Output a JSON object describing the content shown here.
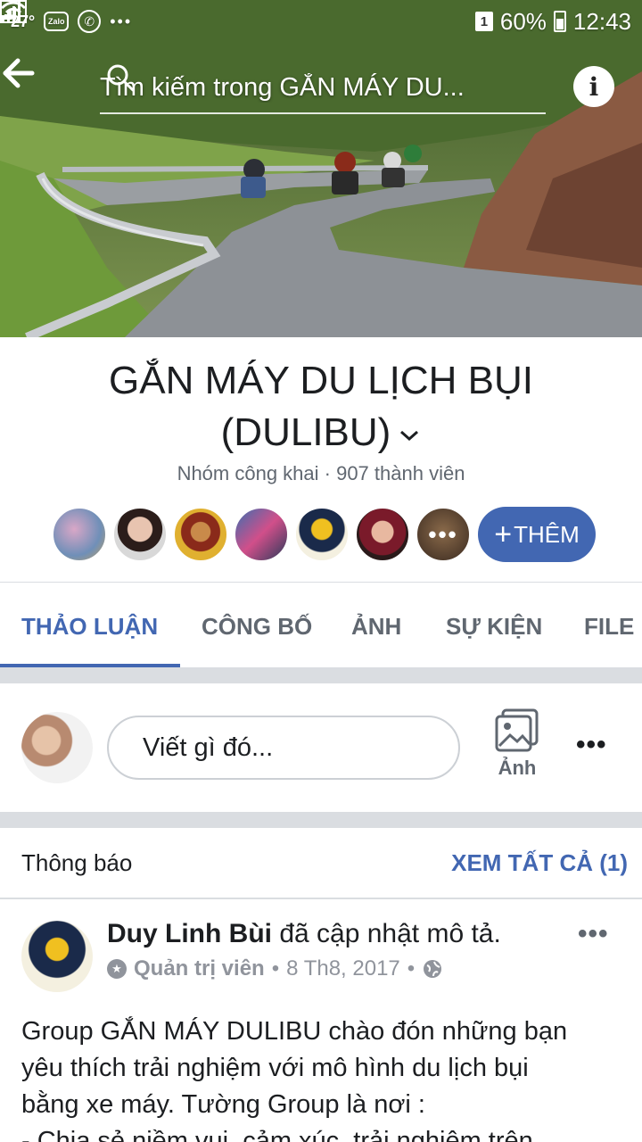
{
  "status_bar": {
    "temperature": "27°",
    "zalo": "Zalo",
    "more": "•••",
    "sim": "1",
    "battery": "60%",
    "time": "12:43"
  },
  "header": {
    "search_placeholder": "Tìm kiếm trong GẮN MÁY DU..."
  },
  "group": {
    "title_line1": "GẮN MÁY DU LỊCH BỤI",
    "title_line2": "(DULIBU)",
    "meta": "Nhóm công khai · 907 thành viên",
    "more_members": "•••",
    "add_button": "THÊM"
  },
  "tabs": [
    {
      "label": "THẢO LUẬN"
    },
    {
      "label": "CÔNG BỐ"
    },
    {
      "label": "ẢNH"
    },
    {
      "label": "SỰ KIỆN"
    },
    {
      "label": "FILE"
    }
  ],
  "composer": {
    "placeholder": "Viết gì đó...",
    "photo_label": "Ảnh",
    "more": "•••"
  },
  "announcements": {
    "title": "Thông báo",
    "see_all": "XEM TẤT CẢ (1)"
  },
  "post": {
    "author": "Duy Linh Bùi",
    "action": "đã cập nhật mô tả.",
    "role": "Quản trị viên",
    "date": "8 Th8, 2017",
    "more": "•••",
    "body_lines": [
      "Group GẮN MÁY DULIBU chào đón những bạn",
      "yêu thích trải nghiệm với mô hình du lịch bụi",
      "bằng xe máy. Tường Group là nơi :",
      "- Chia sẻ niềm vui, cảm xúc, trải nghiệm trên"
    ]
  },
  "colors": {
    "accent": "#4267b2",
    "text": "#1c1e21",
    "muted": "#606770",
    "divider": "#dadde1"
  }
}
